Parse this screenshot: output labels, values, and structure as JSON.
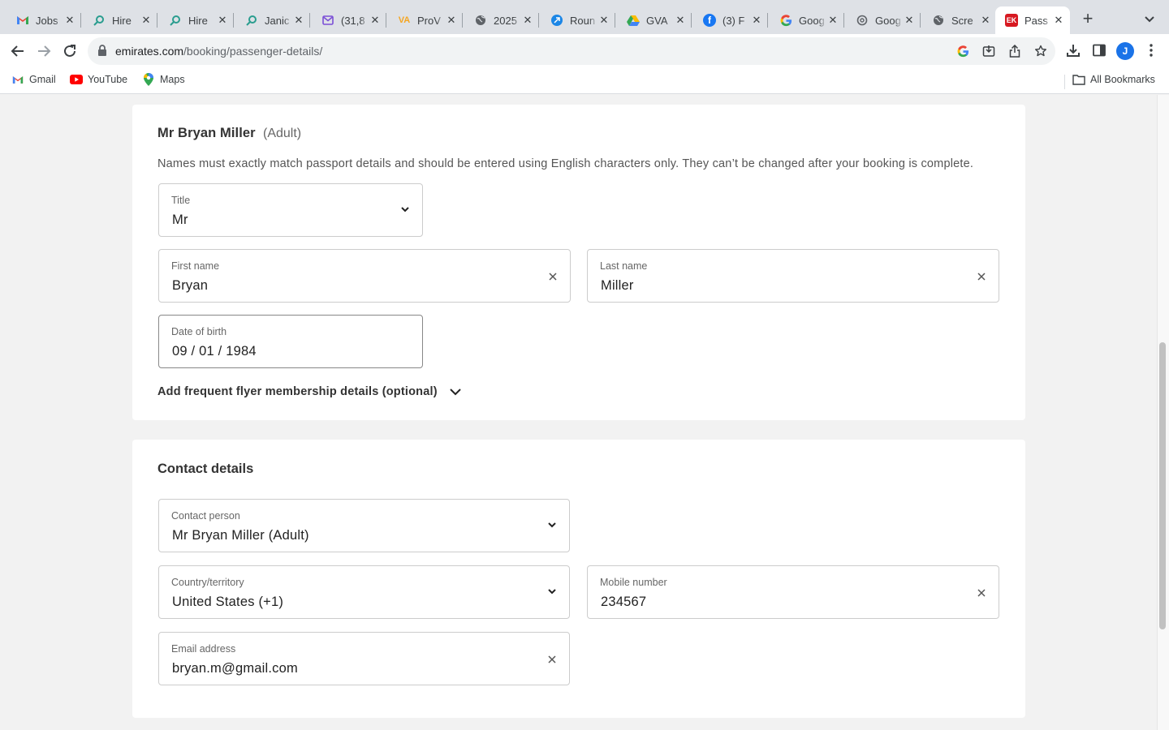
{
  "browser": {
    "tabs": [
      {
        "title": "Jobs",
        "favicon": "gmail-icon",
        "active": false
      },
      {
        "title": "Hire",
        "favicon": "hire-search-icon",
        "active": false
      },
      {
        "title": "Hire",
        "favicon": "hire-search-icon",
        "active": false
      },
      {
        "title": "Janic",
        "favicon": "hire-search-icon",
        "active": false
      },
      {
        "title": "(31,8",
        "favicon": "mail-icon",
        "active": false
      },
      {
        "title": "ProV",
        "favicon": "va-icon",
        "active": false
      },
      {
        "title": "2025",
        "favicon": "globe-icon",
        "active": false
      },
      {
        "title": "Roun",
        "favicon": "plane-icon",
        "active": false
      },
      {
        "title": "GVA",
        "favicon": "drive-icon",
        "active": false
      },
      {
        "title": "(3) F",
        "favicon": "facebook-icon",
        "active": false
      },
      {
        "title": "Goog",
        "favicon": "google-icon",
        "active": false
      },
      {
        "title": "Goog",
        "favicon": "openai-icon",
        "active": false
      },
      {
        "title": "Scre",
        "favicon": "globe-icon",
        "active": false
      },
      {
        "title": "Pass",
        "favicon": "emirates-icon",
        "active": true
      }
    ],
    "url_host": "emirates.com",
    "url_path": "/booking/passenger-details/",
    "profile_initial": "J",
    "bookmarks": [
      {
        "label": "Gmail",
        "icon": "gmail-icon"
      },
      {
        "label": "YouTube",
        "icon": "youtube-icon"
      },
      {
        "label": "Maps",
        "icon": "maps-icon"
      }
    ],
    "all_bookmarks": "All Bookmarks"
  },
  "passenger": {
    "name": "Mr Bryan Miller",
    "type": "(Adult)",
    "note": "Names must exactly match passport details and should be entered using English characters only. They can’t be changed after your booking is complete.",
    "title": {
      "label": "Title",
      "value": "Mr"
    },
    "first_name": {
      "label": "First name",
      "value": "Bryan"
    },
    "last_name": {
      "label": "Last name",
      "value": "Miller"
    },
    "dob": {
      "label": "Date of birth",
      "value": "09 / 01 / 1984"
    },
    "frequent_flyer": "Add frequent flyer membership details (optional)"
  },
  "contact": {
    "heading": "Contact details",
    "person": {
      "label": "Contact person",
      "value": "Mr Bryan Miller (Adult)"
    },
    "country": {
      "label": "Country/territory",
      "value": "United States (+1)"
    },
    "mobile": {
      "label": "Mobile number",
      "value": "234567"
    },
    "email": {
      "label": "Email address",
      "value": "bryan.m@gmail.com"
    }
  },
  "colors": {
    "emirates_red": "#d71921",
    "chrome_bg": "#dee1e6",
    "page_bg": "#f2f2f2"
  }
}
